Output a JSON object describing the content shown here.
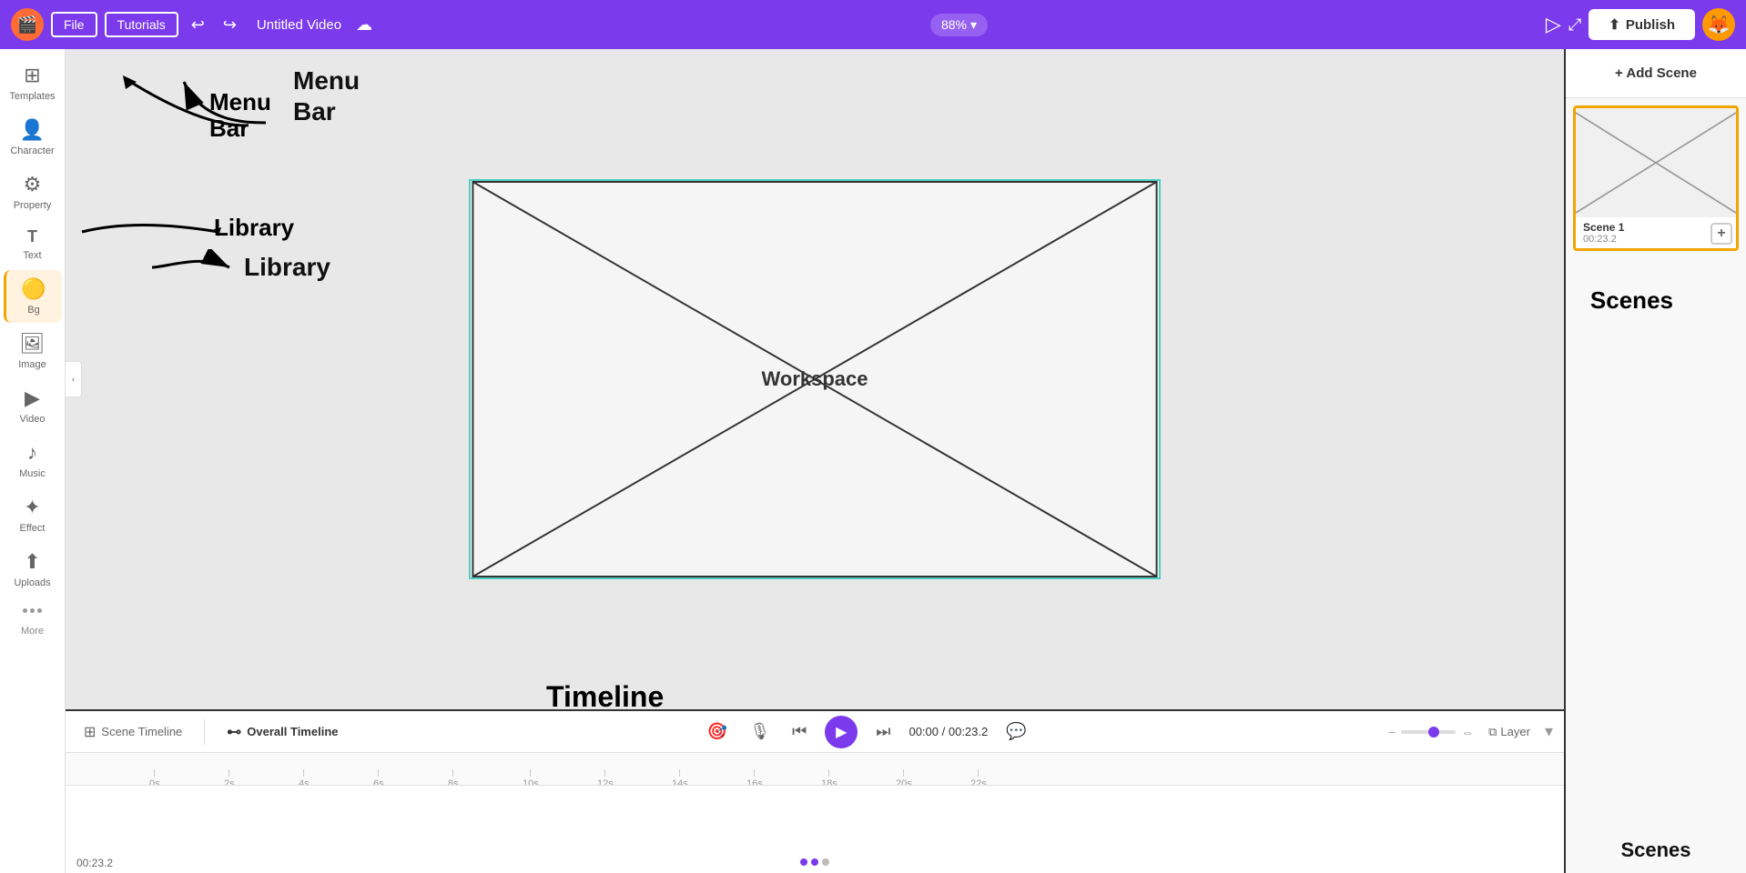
{
  "topbar": {
    "logo": "🎬",
    "file_label": "File",
    "tutorials_label": "Tutorials",
    "title": "Untitled Video",
    "zoom": "88%",
    "publish_label": "Publish",
    "avatar": "🦊"
  },
  "sidebar": {
    "items": [
      {
        "id": "templates",
        "icon": "⊞",
        "label": "Templates"
      },
      {
        "id": "character",
        "icon": "👤",
        "label": "Character"
      },
      {
        "id": "property",
        "icon": "🔧",
        "label": "Property"
      },
      {
        "id": "text",
        "icon": "T",
        "label": "Text"
      },
      {
        "id": "bg",
        "icon": "🟡",
        "label": "Bg",
        "active": true
      },
      {
        "id": "image",
        "icon": "🖼",
        "label": "Image"
      },
      {
        "id": "video",
        "icon": "▶",
        "label": "Video"
      },
      {
        "id": "music",
        "icon": "♪",
        "label": "Music"
      },
      {
        "id": "effect",
        "icon": "✨",
        "label": "Effect"
      },
      {
        "id": "uploads",
        "icon": "⬆",
        "label": "Uploads"
      }
    ],
    "more_label": "More"
  },
  "workspace": {
    "label": "Workspace"
  },
  "annotations": {
    "menu_bar": {
      "title": "Menu",
      "subtitle": "Bar"
    },
    "library": {
      "label": "Library"
    },
    "timeline": {
      "label": "Timeline"
    },
    "scenes": {
      "label": "Scenes"
    }
  },
  "timeline": {
    "scene_tab": "Scene Timeline",
    "overall_tab": "Overall Timeline",
    "current_time": "00:00",
    "total_time": "00:23.2",
    "layer_label": "Layer",
    "current_time_display": "00:23.2",
    "ruler_marks": [
      "2s",
      "4s",
      "6s",
      "8s",
      "10s",
      "12s",
      "14s",
      "16s",
      "18s",
      "20s",
      "22s"
    ]
  },
  "scenes": {
    "add_label": "+ Add Scene",
    "scene1": {
      "name": "Scene 1",
      "duration": "00:23.2"
    }
  }
}
